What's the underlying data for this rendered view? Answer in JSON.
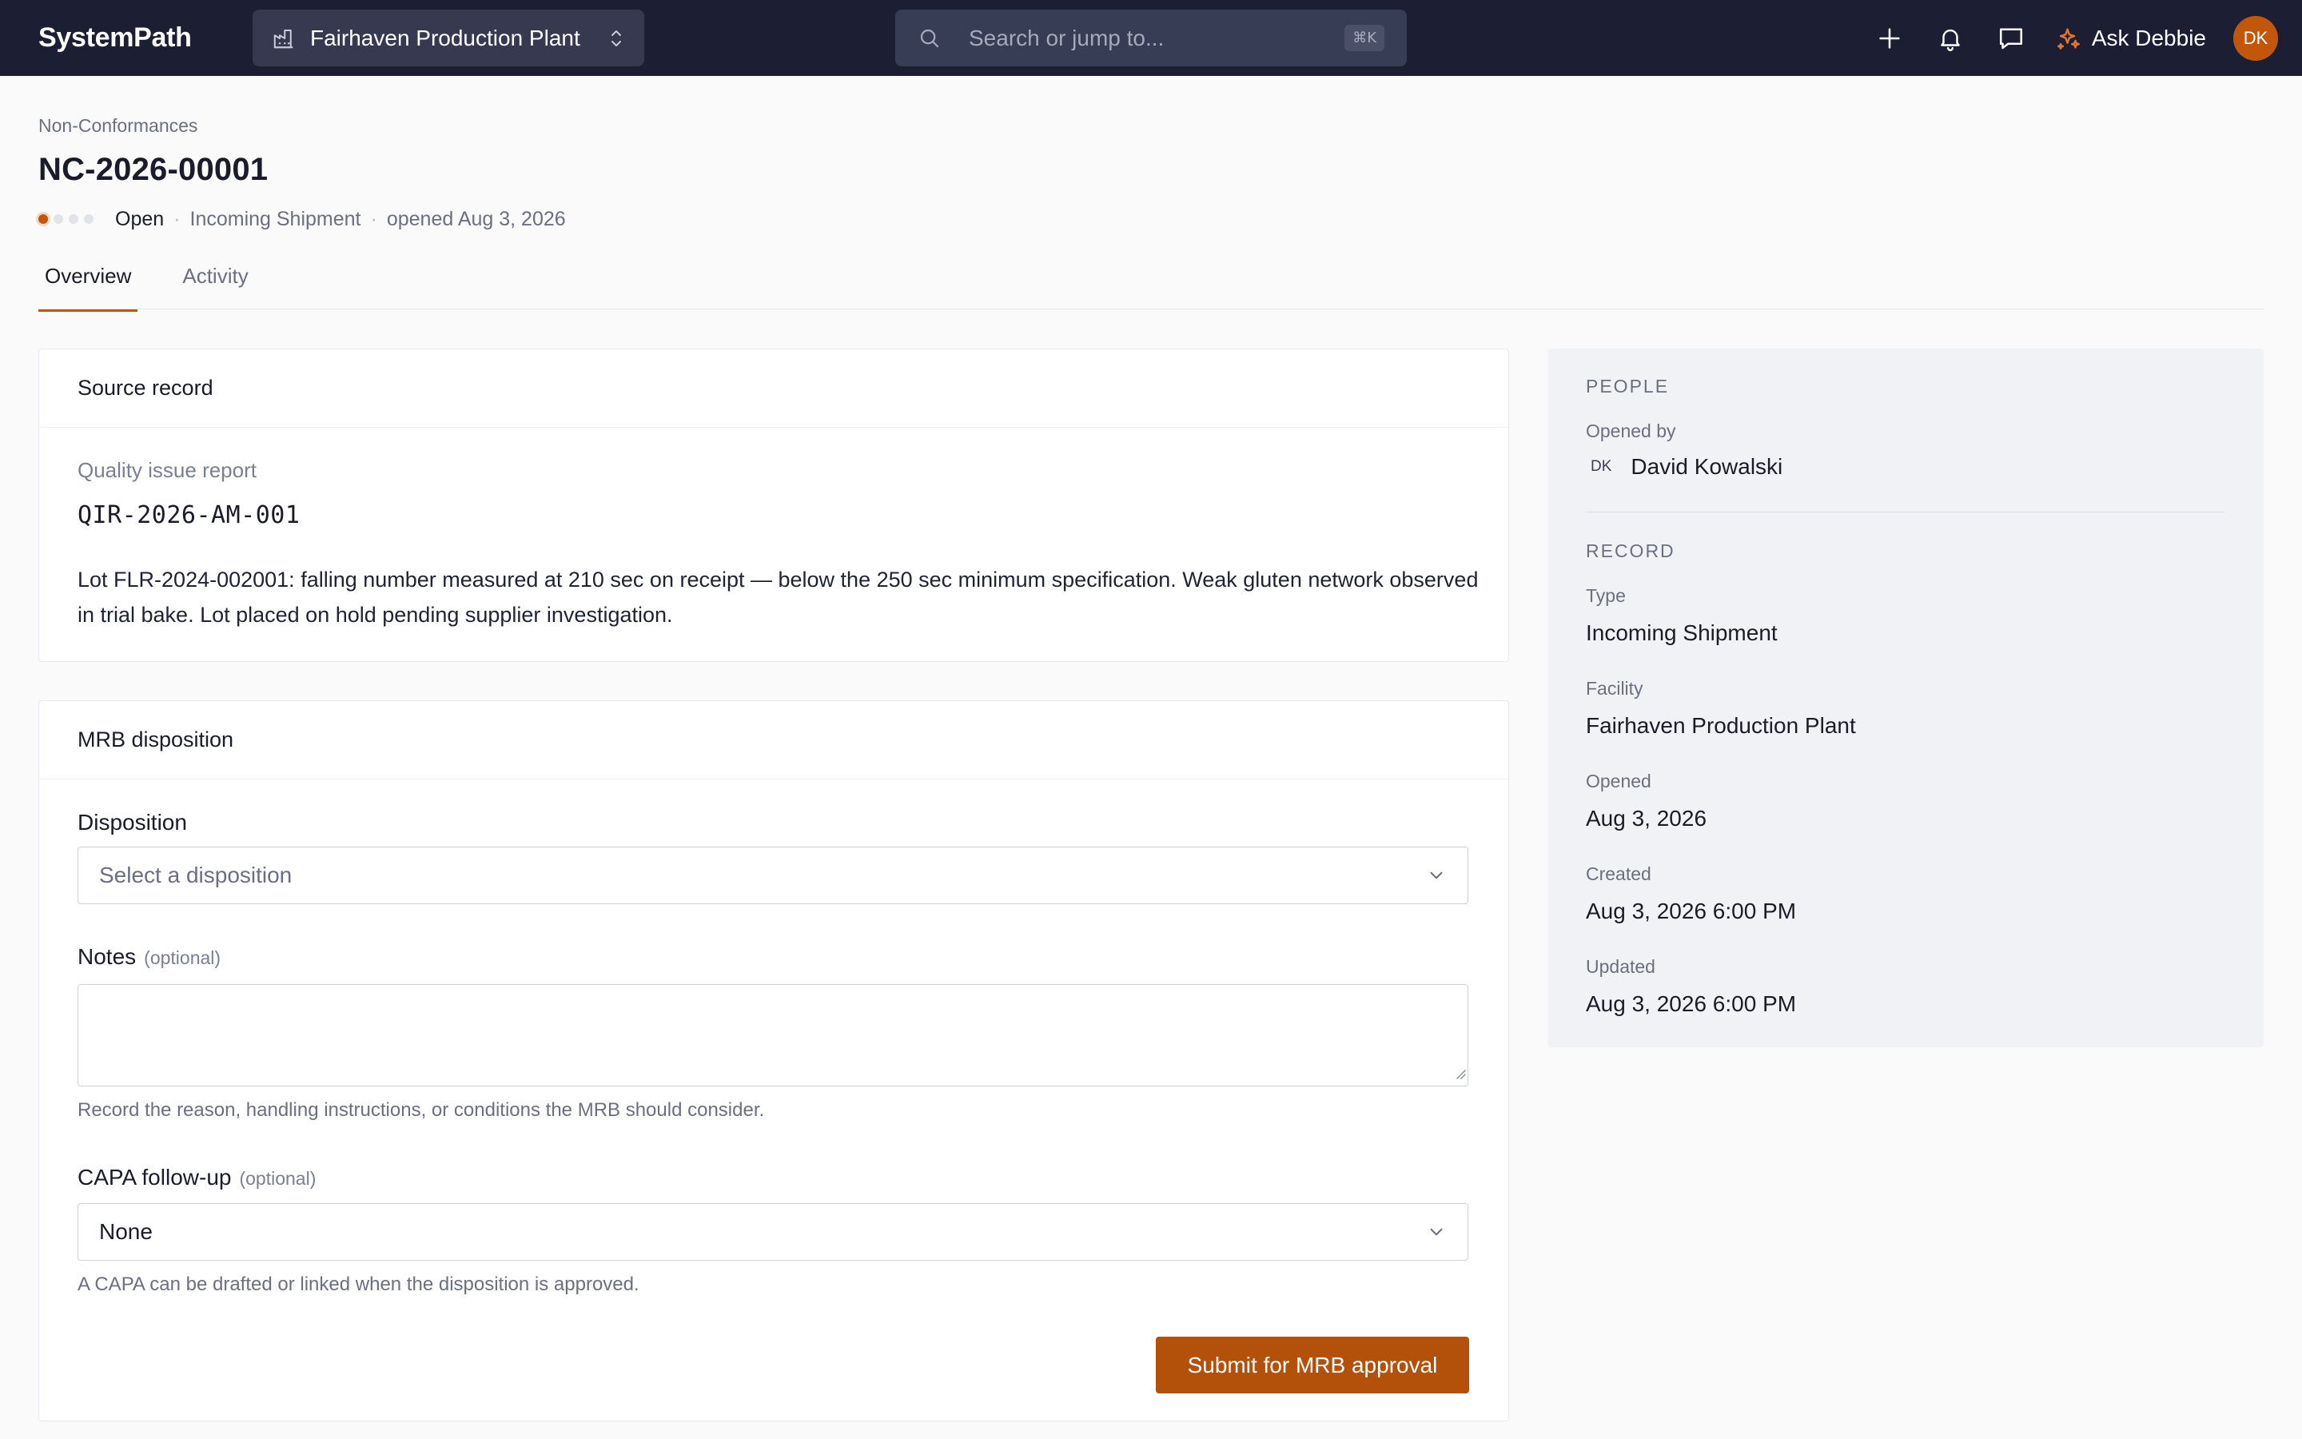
{
  "app": {
    "brand": "SystemPath",
    "facility": "Fairhaven Production Plant",
    "search_placeholder": "Search or jump to...",
    "search_shortcut": "⌘K",
    "ask_label": "Ask Debbie",
    "user_initials": "DK"
  },
  "header": {
    "breadcrumb": "Non-Conformances",
    "title": "NC-2026-00001",
    "status": "Open",
    "type": "Incoming Shipment",
    "opened": "opened Aug 3, 2026",
    "stage_progress": {
      "current": 1,
      "total": 4
    }
  },
  "tabs": [
    {
      "label": "Overview",
      "active": true
    },
    {
      "label": "Activity",
      "active": false
    }
  ],
  "source_record": {
    "heading": "Source record",
    "label": "Quality issue report",
    "id": "QIR-2026-AM-001",
    "description": "Lot FLR-2024-002001: falling number measured at 210 sec on receipt — below the 250 sec minimum specification. Weak gluten network observed in trial bake. Lot placed on hold pending supplier investigation."
  },
  "mrb": {
    "heading": "MRB disposition",
    "disposition_label": "Disposition",
    "disposition_placeholder": "Select a disposition",
    "notes_label": "Notes",
    "notes_optional": "(optional)",
    "notes_value": "",
    "notes_help": "Record the reason, handling instructions, or conditions the MRB should consider.",
    "capa_label": "CAPA follow-up",
    "capa_optional": "(optional)",
    "capa_value": "None",
    "capa_help": "A CAPA can be drafted or linked when the disposition is approved.",
    "submit_label": "Submit for MRB approval"
  },
  "side": {
    "people_title": "PEOPLE",
    "opened_by_label": "Opened by",
    "opened_by_initials": "DK",
    "opened_by_name": "David Kowalski",
    "record_title": "RECORD",
    "type_label": "Type",
    "type_value": "Incoming Shipment",
    "facility_label": "Facility",
    "facility_value": "Fairhaven Production Plant",
    "opened_label": "Opened",
    "opened_value": "Aug 3, 2026",
    "created_label": "Created",
    "created_value": "Aug 3, 2026 6:00 PM",
    "updated_label": "Updated",
    "updated_value": "Aug 3, 2026 6:00 PM"
  },
  "colors": {
    "topbar": "#1c1e33",
    "accent": "#c2570c",
    "submit": "#b3510b"
  },
  "icons": {
    "facility": "factory-icon",
    "switcher": "chevron-up-down-icon",
    "search": "search-icon",
    "add": "plus-icon",
    "notifications": "bell-icon",
    "messages": "chat-bubble-icon",
    "assistant": "sparkle-icon",
    "dropdown": "chevron-down-icon"
  }
}
